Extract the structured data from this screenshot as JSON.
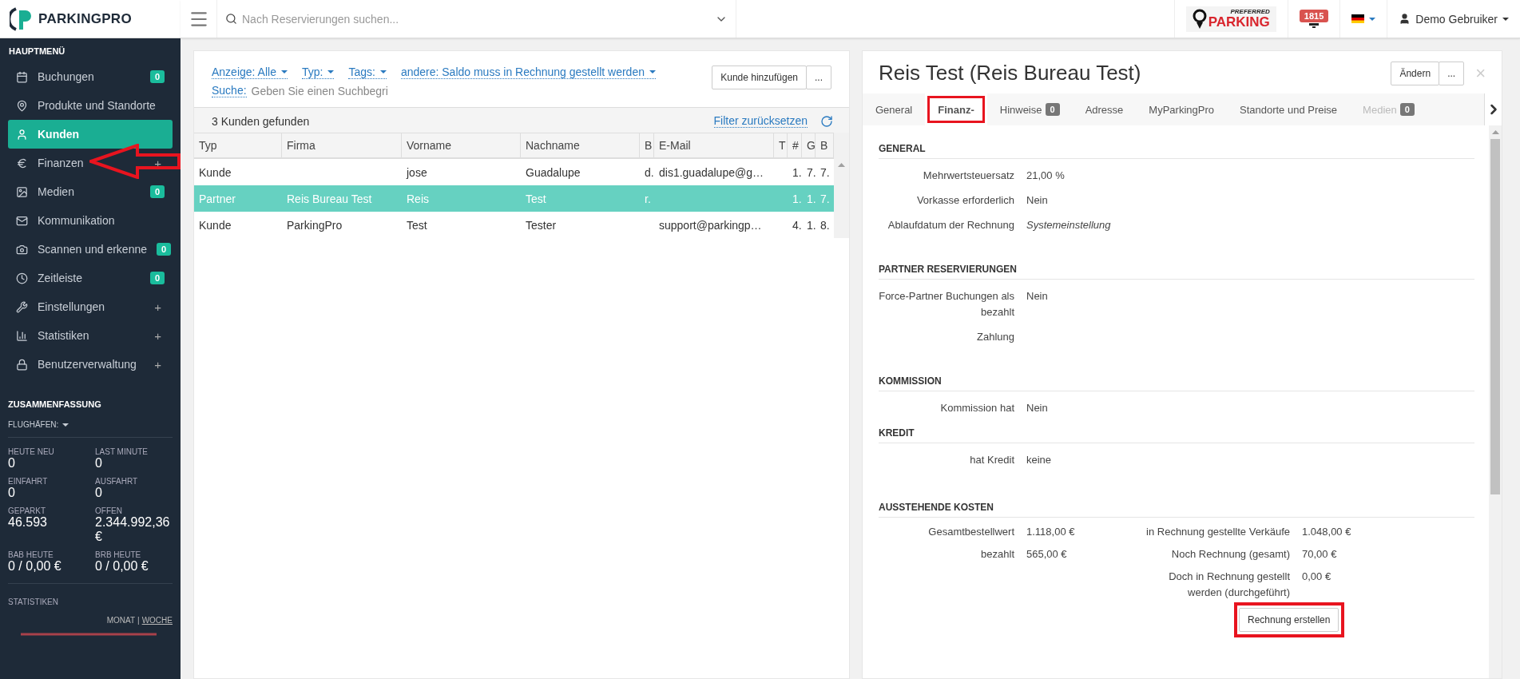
{
  "topbar": {
    "search_placeholder": "Nach Reservierungen suchen...",
    "notification_count": "1815",
    "partner_logo": {
      "top": "PREFERRED",
      "main": "PARKING"
    },
    "user": "Demo Gebruiker"
  },
  "sidebar": {
    "logo": "PARKINGPRO",
    "menu_title": "HAUPTMENÜ",
    "items": [
      {
        "label": "Buchungen",
        "badge": "0",
        "selected": false
      },
      {
        "label": "Produkte und Standorte",
        "selected": false
      },
      {
        "label": "Kunden",
        "selected": true
      },
      {
        "label": "Finanzen",
        "expand": "+",
        "selected": false
      },
      {
        "label": "Medien",
        "badge": "0",
        "selected": false
      },
      {
        "label": "Kommunikation",
        "selected": false
      },
      {
        "label": "Scannen und erkenne",
        "badge": "0",
        "selected": false
      },
      {
        "label": "Zeitleiste",
        "badge": "0",
        "selected": false
      },
      {
        "label": "Einstellungen",
        "expand": "+",
        "selected": false
      },
      {
        "label": "Statistiken",
        "expand": "+",
        "selected": false
      },
      {
        "label": "Benutzerverwaltung",
        "expand": "+",
        "selected": false
      }
    ],
    "summary_title": "ZUSAMMENFASSUNG",
    "airports": "FLUGHÄFEN:",
    "stats": [
      {
        "label": "HEUTE NEU",
        "value": "0"
      },
      {
        "label": "LAST MINUTE",
        "value": "0"
      },
      {
        "label": "EINFAHRT",
        "value": "0"
      },
      {
        "label": "AUSFAHRT",
        "value": "0"
      },
      {
        "label": "GEPARKT",
        "value": "46.593"
      },
      {
        "label": "OFFEN",
        "value": "2.344.992,36 €"
      },
      {
        "label": "BAB HEUTE",
        "value": "0 / 0,00 €"
      },
      {
        "label": "BRB HEUTE",
        "value": "0 / 0,00 €"
      }
    ],
    "statistics_title": "STATISTIKEN",
    "periods": [
      {
        "label": "MONAT",
        "selected": false
      },
      {
        "label": "WOCHE",
        "selected": true
      }
    ],
    "period_separator": "|"
  },
  "list": {
    "filters": [
      "Anzeige: Alle",
      "Typ:",
      "Tags:",
      "andere: Saldo muss in Rechnung gestellt werden"
    ],
    "search_label": "Suche:",
    "search_placeholder": "Geben Sie einen Suchbegri",
    "buttons": [
      "Kunde hinzufügen",
      "..."
    ],
    "count": "3 Kunden gefunden",
    "reset": "Filter zurücksetzen",
    "table": {
      "columns": [
        "Typ",
        "Firma",
        "Vorname",
        "Nachname",
        "B",
        "E-Mail",
        "T",
        "#",
        "G",
        "B"
      ],
      "rows": [
        {
          "cells": [
            "Kunde",
            "",
            "jose",
            "Guadalupe",
            "d.",
            "dis1.guadalupe@g…",
            "",
            "1.",
            "7.",
            "7."
          ],
          "selected": false
        },
        {
          "cells": [
            "Partner",
            "Reis Bureau Test",
            "Reis",
            "Test",
            "r.",
            "",
            "",
            "1.",
            "1.",
            "7."
          ],
          "selected": true
        },
        {
          "cells": [
            "Kunde",
            "ParkingPro",
            "Test",
            "Tester",
            "",
            "support@parkingp…",
            "",
            "4.",
            "1.",
            "8."
          ],
          "selected": false
        }
      ]
    }
  },
  "detail": {
    "title": "Reis Test (Reis Bureau Test)",
    "buttons": [
      "Ändern",
      "..."
    ],
    "close": "×",
    "tabs": [
      {
        "label": "General",
        "selected": false,
        "disabled": false
      },
      {
        "label": "Finanz-",
        "selected": true,
        "disabled": false
      },
      {
        "label": "Hinweise",
        "badge": "0",
        "selected": false,
        "disabled": false
      },
      {
        "label": "Adresse",
        "selected": false,
        "disabled": false
      },
      {
        "label": "MyParkingPro",
        "selected": false,
        "disabled": false
      },
      {
        "label": "Standorte und Preise",
        "selected": false,
        "disabled": false
      },
      {
        "label": "Medien",
        "badge": "0",
        "selected": false,
        "disabled": true
      }
    ],
    "sections": [
      {
        "title": "GENERAL",
        "rows": [
          {
            "label": "Mehrwertsteuersatz",
            "value": "21,00 %"
          },
          {
            "label": "Vorkasse erforderlich",
            "value": "Nein"
          },
          {
            "label": "Ablaufdatum der Rechnung",
            "value": "Systemeinstellung",
            "italic": true
          }
        ]
      },
      {
        "title": "PARTNER RESERVIERUNGEN",
        "rows": [
          {
            "label": "Force-Partner Buchungen als bezahlt",
            "value": "Nein"
          },
          {
            "label": "Zahlung"
          }
        ]
      },
      {
        "title": "KOMMISSION",
        "rows": [
          {
            "label": "Kommission hat",
            "value": "Nein"
          }
        ]
      },
      {
        "title": "KREDIT",
        "rows": [
          {
            "label": "hat Kredit",
            "value": "keine"
          }
        ]
      }
    ],
    "costs": {
      "title": "AUSSTEHENDE KOSTEN",
      "left": [
        {
          "label": "Gesamtbestellwert",
          "value": "1.118,00 €"
        },
        {
          "label": "bezahlt",
          "value": "565,00 €"
        }
      ],
      "right": [
        {
          "label": "in Rechnung gestellte Verkäufe",
          "value": "1.048,00 €"
        },
        {
          "label": "Noch Rechnung (gesamt)",
          "value": "70,00 €"
        },
        {
          "label": "Doch in Rechnung gestellt werden (durchgeführt)",
          "value": "0,00 €"
        }
      ],
      "button": "Rechnung erstellen"
    }
  }
}
